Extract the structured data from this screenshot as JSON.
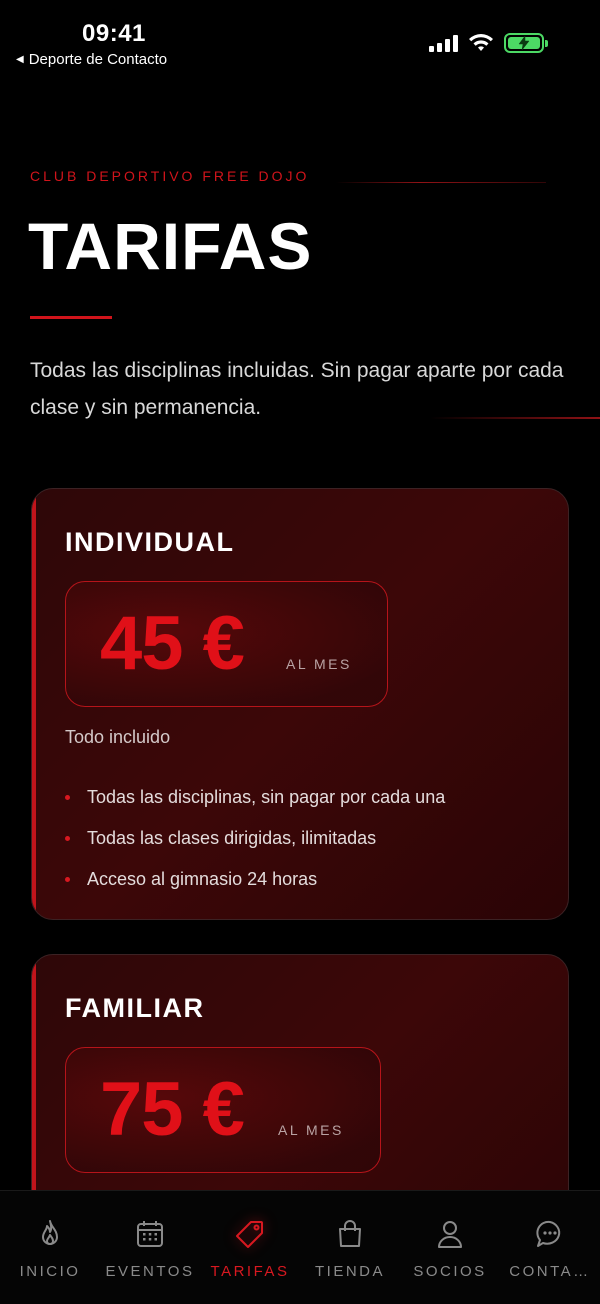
{
  "status_bar": {
    "time": "09:41",
    "back_label": "Deporte de Contacto"
  },
  "header": {
    "club_name": "CLUB DEPORTIVO FREE DOJO",
    "title": "TARIFAS",
    "intro": "Todas las disciplinas incluidas. Sin pagar aparte por cada clase y sin permanencia."
  },
  "plans": [
    {
      "name": "INDIVIDUAL",
      "price": "45 €",
      "period": "AL MES",
      "subtitle": "Todo incluido",
      "features": [
        "Todas las disciplinas, sin pagar por cada una",
        "Todas las clases dirigidas, ilimitadas",
        "Acceso al gimnasio 24 horas"
      ]
    },
    {
      "name": "FAMILIAR",
      "price": "75 €",
      "period": "AL MES"
    }
  ],
  "tab_bar": {
    "active": "TARIFAS",
    "tabs": [
      {
        "label": "INICIO",
        "icon": "flame-icon"
      },
      {
        "label": "EVENTOS",
        "icon": "calendar-icon"
      },
      {
        "label": "TARIFAS",
        "icon": "tag-icon"
      },
      {
        "label": "TIENDA",
        "icon": "shopping-bag-icon"
      },
      {
        "label": "SOCIOS",
        "icon": "person-icon"
      },
      {
        "label": "CONTA…",
        "icon": "chat-bubble-icon"
      }
    ]
  },
  "colors": {
    "accent": "#d81820",
    "background": "#000000",
    "card": "#3a0708"
  }
}
